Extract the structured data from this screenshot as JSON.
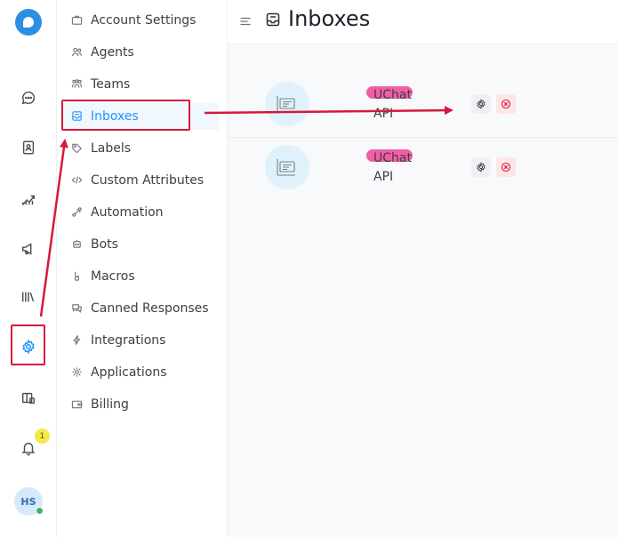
{
  "rail": {
    "notification_count": "1",
    "avatar_initials": "HS"
  },
  "sidebar": {
    "items": [
      {
        "label": "Account Settings",
        "icon": "briefcase-icon"
      },
      {
        "label": "Agents",
        "icon": "people-icon"
      },
      {
        "label": "Teams",
        "icon": "team-icon"
      },
      {
        "label": "Inboxes",
        "icon": "inbox-icon",
        "active": true
      },
      {
        "label": "Labels",
        "icon": "tag-icon"
      },
      {
        "label": "Custom Attributes",
        "icon": "code-icon"
      },
      {
        "label": "Automation",
        "icon": "automation-icon"
      },
      {
        "label": "Bots",
        "icon": "bot-icon"
      },
      {
        "label": "Macros",
        "icon": "macro-icon"
      },
      {
        "label": "Canned Responses",
        "icon": "chat-bubbles-icon"
      },
      {
        "label": "Integrations",
        "icon": "flash-icon"
      },
      {
        "label": "Applications",
        "icon": "apps-icon"
      },
      {
        "label": "Billing",
        "icon": "wallet-icon"
      }
    ]
  },
  "header": {
    "title": "Inboxes"
  },
  "inboxes": [
    {
      "name": "UChat",
      "type": "API"
    },
    {
      "name": "UChat",
      "type": "API"
    }
  ],
  "colors": {
    "accent": "#1f93ff",
    "annotation_red": "#d6193c",
    "redaction_pink": "#f14d9c"
  }
}
